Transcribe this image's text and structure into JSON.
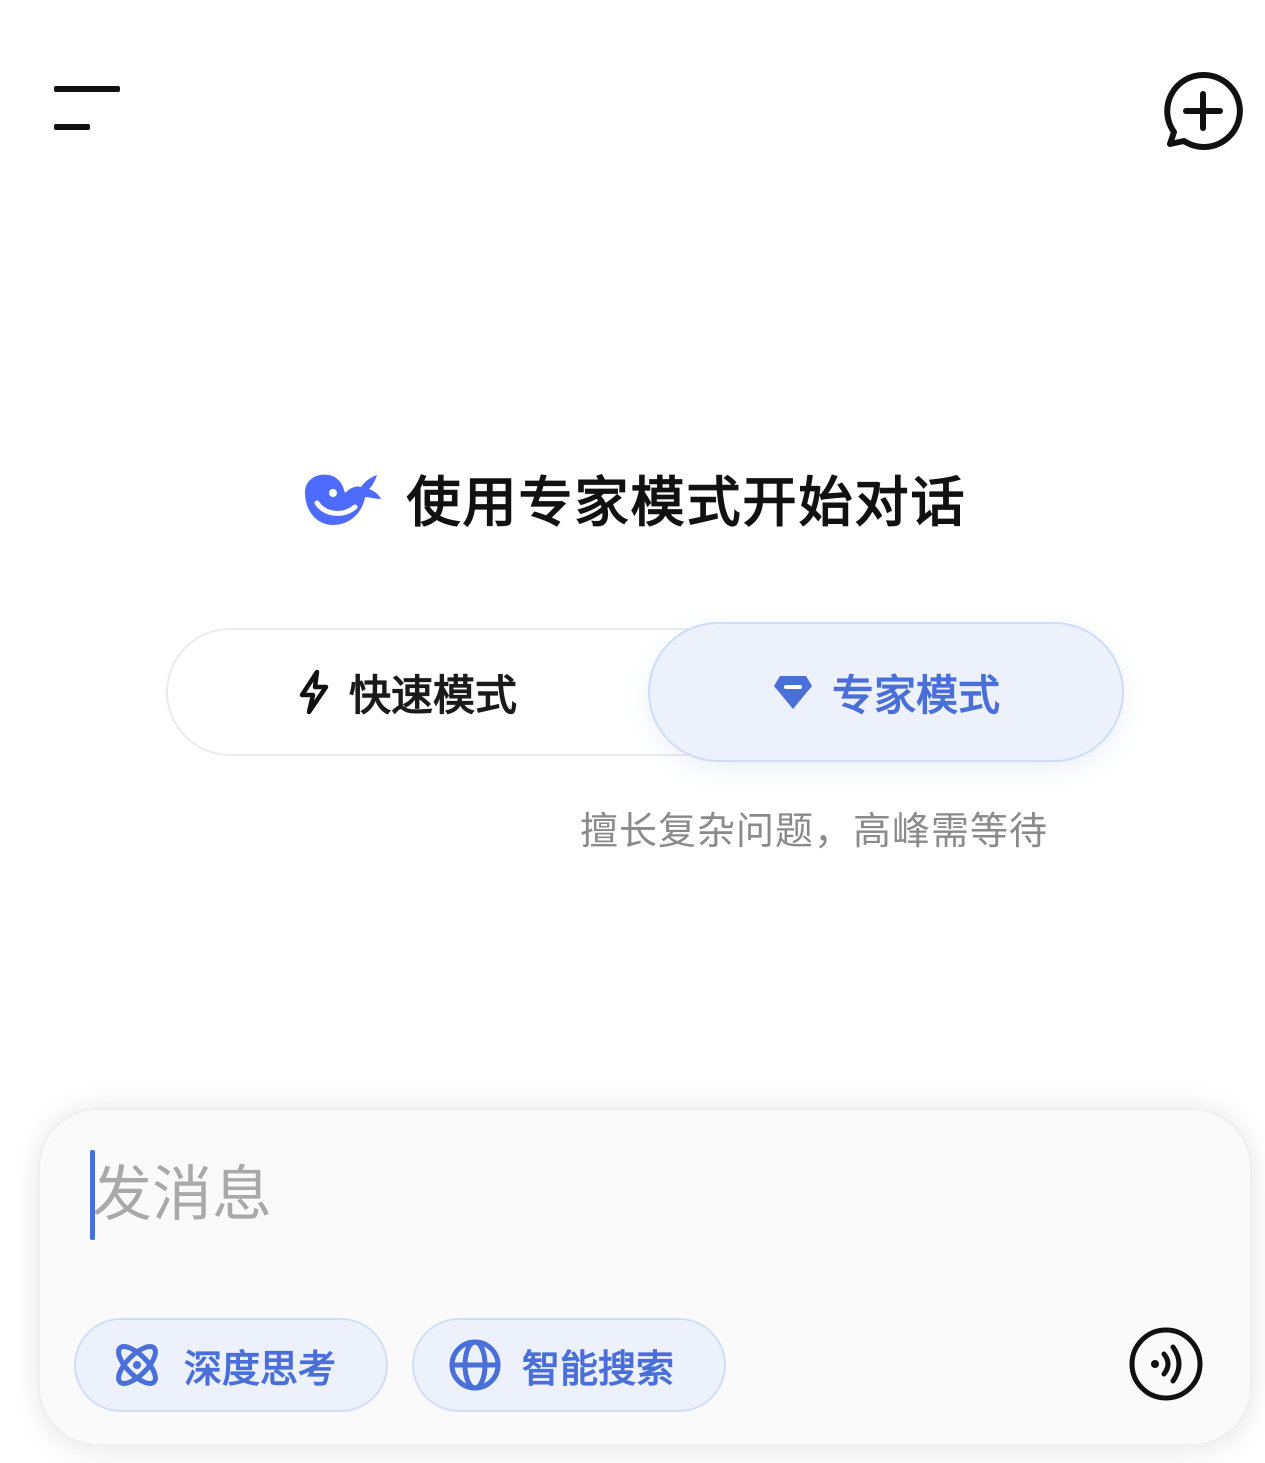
{
  "header": {
    "menu_icon": "menu-icon",
    "new_chat_icon": "new-chat-icon"
  },
  "hero": {
    "logo_icon": "whale-logo-icon",
    "title": "使用专家模式开始对话"
  },
  "mode_toggle": {
    "fast": {
      "label": "快速模式",
      "icon": "lightning-icon",
      "selected": false
    },
    "expert": {
      "label": "专家模式",
      "icon": "diamond-icon",
      "selected": true
    },
    "description": "擅长复杂问题，高峰需等待"
  },
  "composer": {
    "placeholder": "发消息",
    "value": "",
    "chips": [
      {
        "label": "深度思考",
        "icon": "atom-icon"
      },
      {
        "label": "智能搜索",
        "icon": "globe-icon"
      }
    ],
    "voice_icon": "voice-icon"
  },
  "colors": {
    "accent": "#4a6fd8",
    "accent_bg": "#ecf1fc",
    "text": "#111111",
    "muted": "#8a8a8a"
  }
}
